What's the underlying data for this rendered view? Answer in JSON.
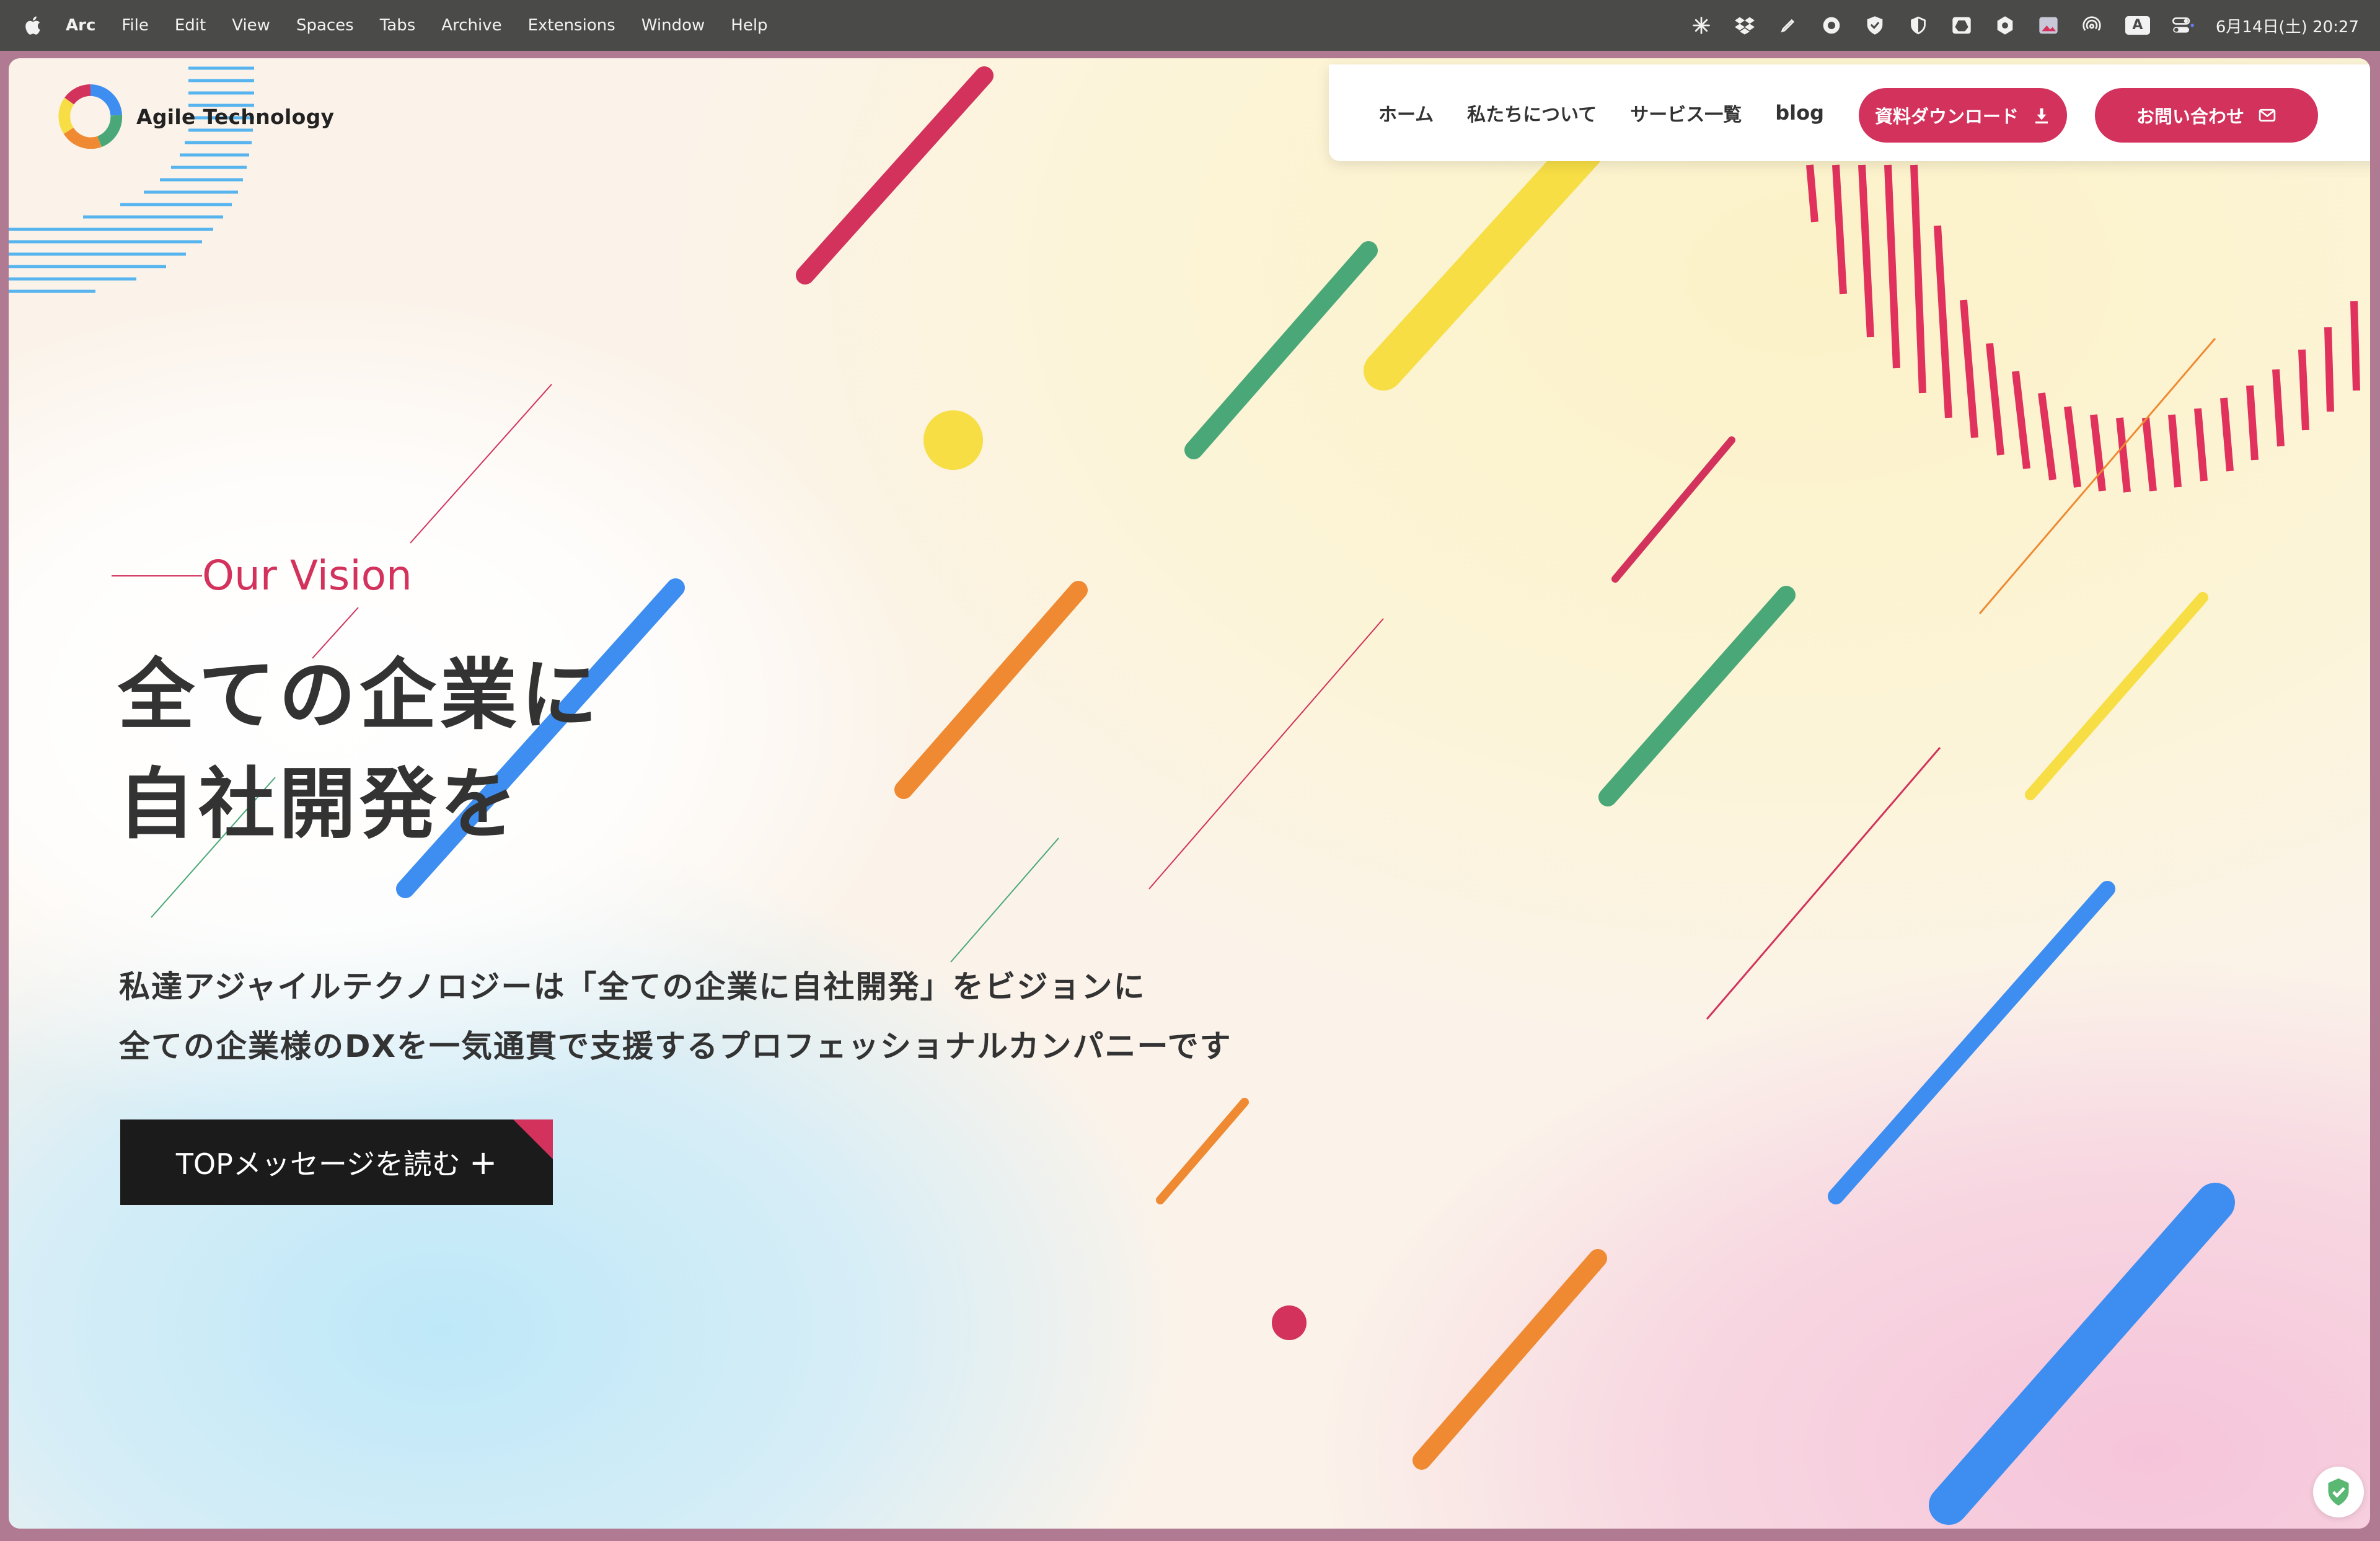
{
  "menubar": {
    "app_name": "Arc",
    "items": [
      "File",
      "Edit",
      "View",
      "Spaces",
      "Tabs",
      "Archive",
      "Extensions",
      "Window",
      "Help"
    ],
    "tray_icons": [
      "sparkle-icon",
      "dropbox-icon",
      "pen-icon",
      "record-icon",
      "vpn-shield-icon",
      "shield-half-icon",
      "drive-icon",
      "hex-icon",
      "image-icon",
      "airdrop-icon",
      "input-method-icon",
      "control-center-icon"
    ],
    "input_indicator": "A",
    "clock": "6月14日(土) 20:27"
  },
  "site": {
    "logo_text": "Agile Technology",
    "nav": {
      "links": [
        "ホーム",
        "私たちについて",
        "サービス一覧",
        "blog"
      ],
      "download_label": "資料ダウンロード",
      "contact_label": "お問い合わせ"
    },
    "hero": {
      "eyebrow": "Our Vision",
      "headline_line1": "全ての企業に",
      "headline_line2": "自社開発を",
      "desc_line1": "私達アジャイルテクノロジーは「全ての企業に自社開発」をビジョンに",
      "desc_line2": "全ての企業様のDXを一気通貫で支援するプロフェッショナルカンパニーです",
      "cta_label": "TOPメッセージを読む",
      "cta_plus": "+"
    }
  },
  "colors": {
    "accent": "#d2325c",
    "blue": "#3d8ef0",
    "green": "#4aa878",
    "yellow": "#f7de45",
    "orange": "#ef8a33",
    "dark_button": "#1b1b1b"
  }
}
